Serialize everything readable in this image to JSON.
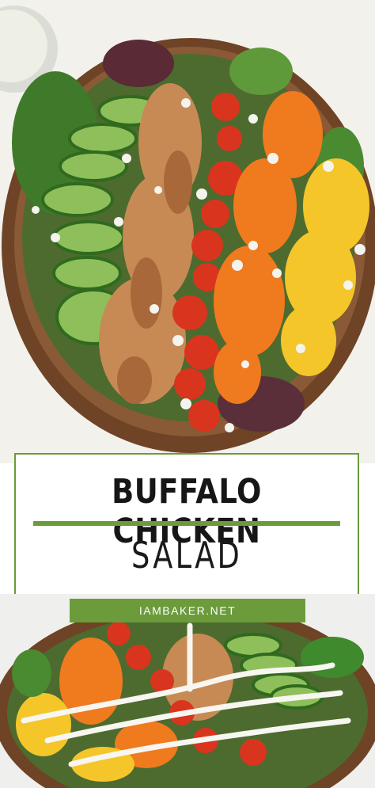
{
  "title": {
    "line1": "BUFFALO CHICKEN",
    "line2": "SALAD"
  },
  "site": {
    "label": "IAMBAKER.NET"
  },
  "colors": {
    "accent_green": "#6b9b3a",
    "title_text": "#161616",
    "bowl_wood": "#7a4a2a"
  }
}
